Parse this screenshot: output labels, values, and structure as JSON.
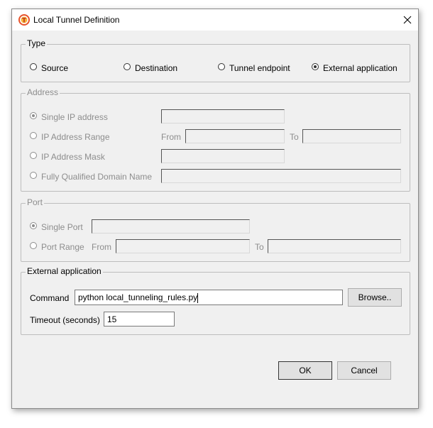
{
  "window": {
    "title": "Local Tunnel Definition"
  },
  "type_group": {
    "label": "Type",
    "options": [
      {
        "label": "Source",
        "checked": false
      },
      {
        "label": "Destination",
        "checked": false
      },
      {
        "label": "Tunnel endpoint",
        "checked": false
      },
      {
        "label": "External application",
        "checked": true
      }
    ]
  },
  "address_group": {
    "label": "Address",
    "single_ip": "Single IP address",
    "ip_range": "IP Address Range",
    "from_label": "From",
    "to_label": "To",
    "ip_mask": "IP Address Mask",
    "fqdn": "Fully Qualified Domain Name"
  },
  "port_group": {
    "label": "Port",
    "single_port": "Single Port",
    "port_range": "Port Range",
    "from_label": "From",
    "to_label": "To"
  },
  "external_group": {
    "label": "External application",
    "command_label": "Command",
    "command_value": "python local_tunneling_rules.py",
    "browse_label": "Browse..",
    "timeout_label": "Timeout (seconds)",
    "timeout_value": "15"
  },
  "buttons": {
    "ok": "OK",
    "cancel": "Cancel"
  },
  "colors": {
    "app_icon": "#e8532b"
  }
}
